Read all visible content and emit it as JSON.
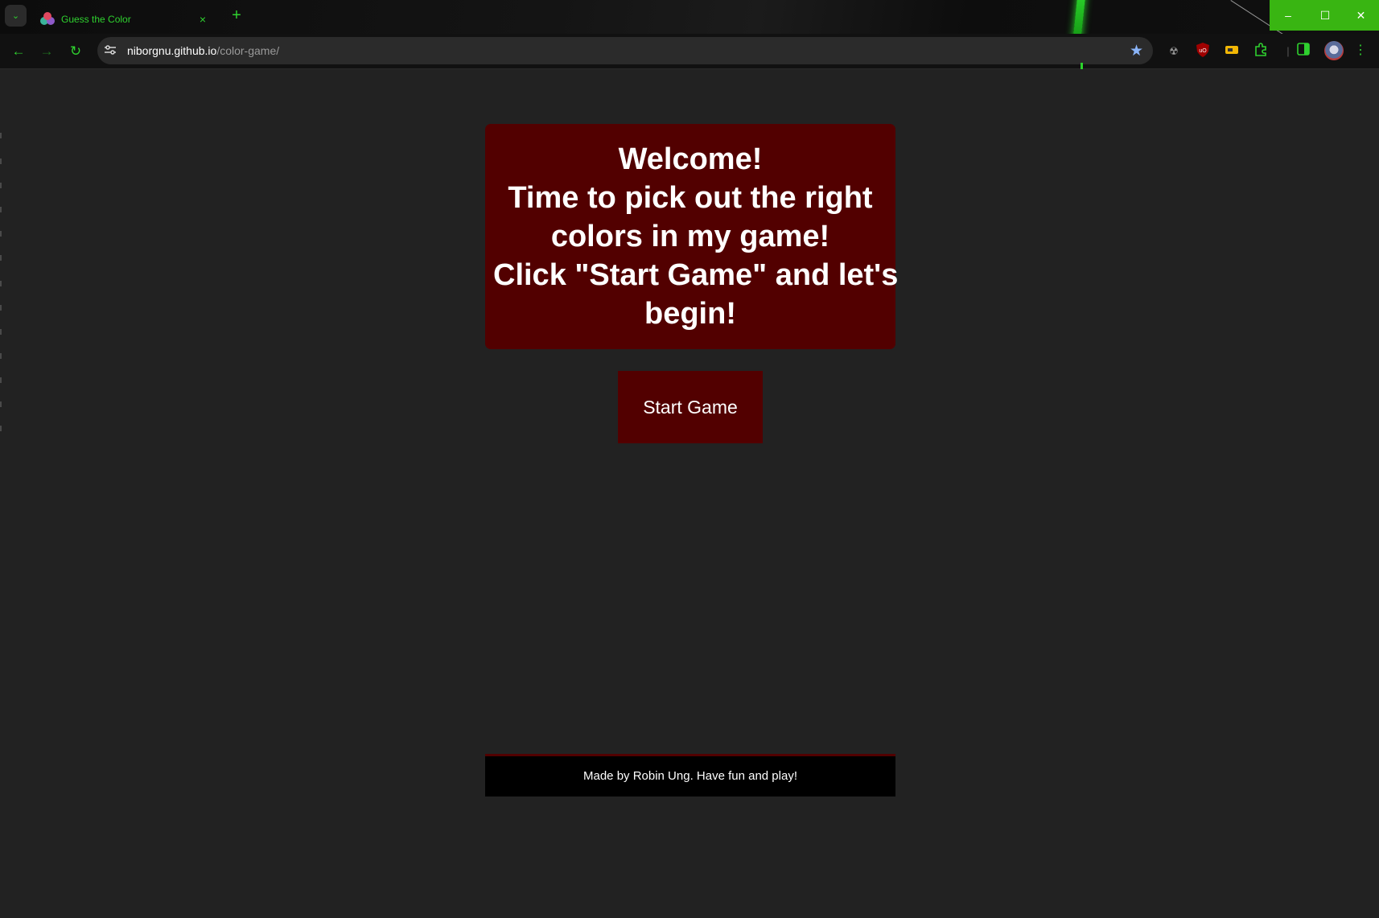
{
  "browser": {
    "tab": {
      "title": "Guess the Color",
      "close_glyph": "×"
    },
    "new_tab_glyph": "+",
    "tab_search_glyph": "⌄",
    "address": {
      "domain": "niborgnu.github.io",
      "path": "/color-game/"
    },
    "window_controls": {
      "minimize": "–",
      "maximize": "☐",
      "close": "✕"
    },
    "nav": {
      "back": "←",
      "forward": "→",
      "reload": "↻"
    },
    "icons": {
      "site_info": "tune-icon",
      "bookmark": "star-icon",
      "extensions": [
        "radiation-icon",
        "ublock-icon",
        "tag-icon",
        "puzzle-icon",
        "sidepanel-icon"
      ],
      "menu": "kebab-menu-icon"
    },
    "accent_color": "#2fd12f"
  },
  "page": {
    "welcome_lines": [
      "Welcome!",
      "Time to pick out the right",
      "colors in my game!",
      "Click \"Start Game\" and let's",
      "begin!"
    ],
    "start_button_label": "Start Game",
    "footer_text": "Made by Robin Ung. Have fun and play!",
    "colors": {
      "background": "#222222",
      "panel": "#520000",
      "footer": "#000000",
      "text": "#ffffff"
    }
  }
}
